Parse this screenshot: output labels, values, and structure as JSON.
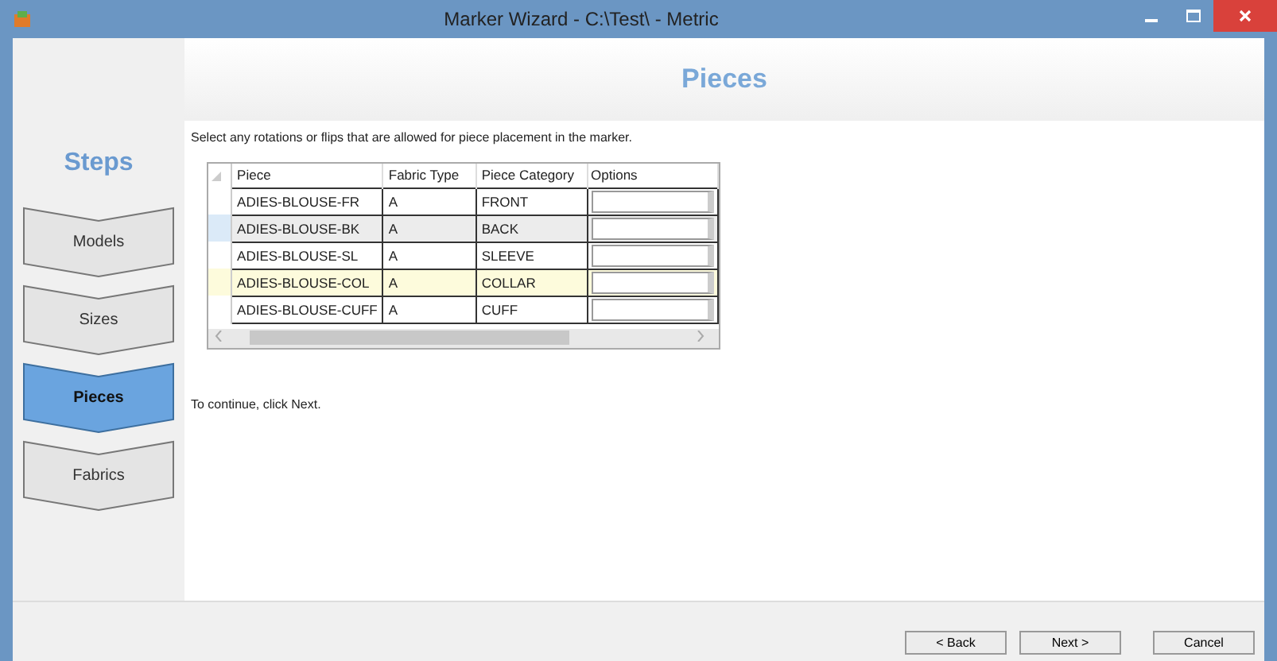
{
  "window": {
    "title": "Marker Wizard - C:\\Test\\ - Metric"
  },
  "header": {
    "title": "Pieces"
  },
  "sidebar": {
    "title": "Steps",
    "items": [
      {
        "label": "Models",
        "selected": false
      },
      {
        "label": "Sizes",
        "selected": false
      },
      {
        "label": "Pieces",
        "selected": true
      },
      {
        "label": "Fabrics",
        "selected": false
      }
    ]
  },
  "instruction": "Select any rotations or flips that are allowed for piece placement in the marker.",
  "table": {
    "columns": [
      "Piece",
      "Fabric Type",
      "Piece Category",
      "Options"
    ],
    "rows": [
      {
        "piece": "ADIES-BLOUSE-FR",
        "fabric_type": "A",
        "category": "FRONT",
        "selected": false,
        "current": false
      },
      {
        "piece": "ADIES-BLOUSE-BK",
        "fabric_type": "A",
        "category": "BACK",
        "selected": true,
        "current": false
      },
      {
        "piece": "ADIES-BLOUSE-SL",
        "fabric_type": "A",
        "category": "SLEEVE",
        "selected": false,
        "current": false
      },
      {
        "piece": "ADIES-BLOUSE-COL",
        "fabric_type": "A",
        "category": "COLLAR",
        "selected": false,
        "current": true
      },
      {
        "piece": "ADIES-BLOUSE-CUFF",
        "fabric_type": "A",
        "category": "CUFF",
        "selected": false,
        "current": false
      }
    ]
  },
  "hint": "To continue, click Next.",
  "buttons": [
    "< Back",
    "Next >",
    "Cancel"
  ]
}
